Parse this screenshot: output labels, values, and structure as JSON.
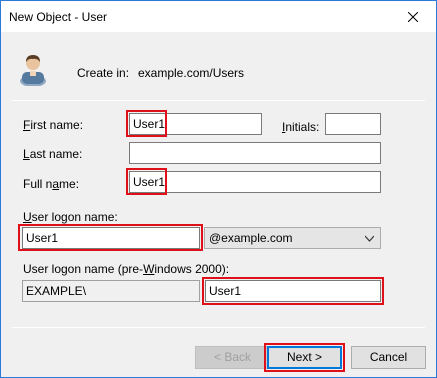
{
  "window": {
    "title": "New Object - User"
  },
  "header": {
    "create_in_label": "Create in:",
    "create_in_value": "example.com/Users"
  },
  "form": {
    "first_name_label": "First name:",
    "first_name_value": "User1",
    "initials_label": "Initials:",
    "initials_value": "",
    "last_name_label": "Last name:",
    "last_name_value": "",
    "full_name_label": "Full name:",
    "full_name_value": "User1",
    "logon_label": "User logon name:",
    "logon_value": "User1",
    "domain_suffix": "@example.com",
    "pre2000_label": "User logon name (pre-Windows 2000):",
    "pre2000_domain": "EXAMPLE\\",
    "pre2000_value": "User1"
  },
  "buttons": {
    "back": "< Back",
    "next": "Next >",
    "cancel": "Cancel"
  },
  "colors": {
    "highlight": "#e0101a",
    "accent": "#0078d7",
    "dialog_bg": "#f0f0f0"
  },
  "icons": {
    "avatar": "user-icon",
    "close": "close-icon",
    "dropdown": "chevron-down-icon"
  }
}
